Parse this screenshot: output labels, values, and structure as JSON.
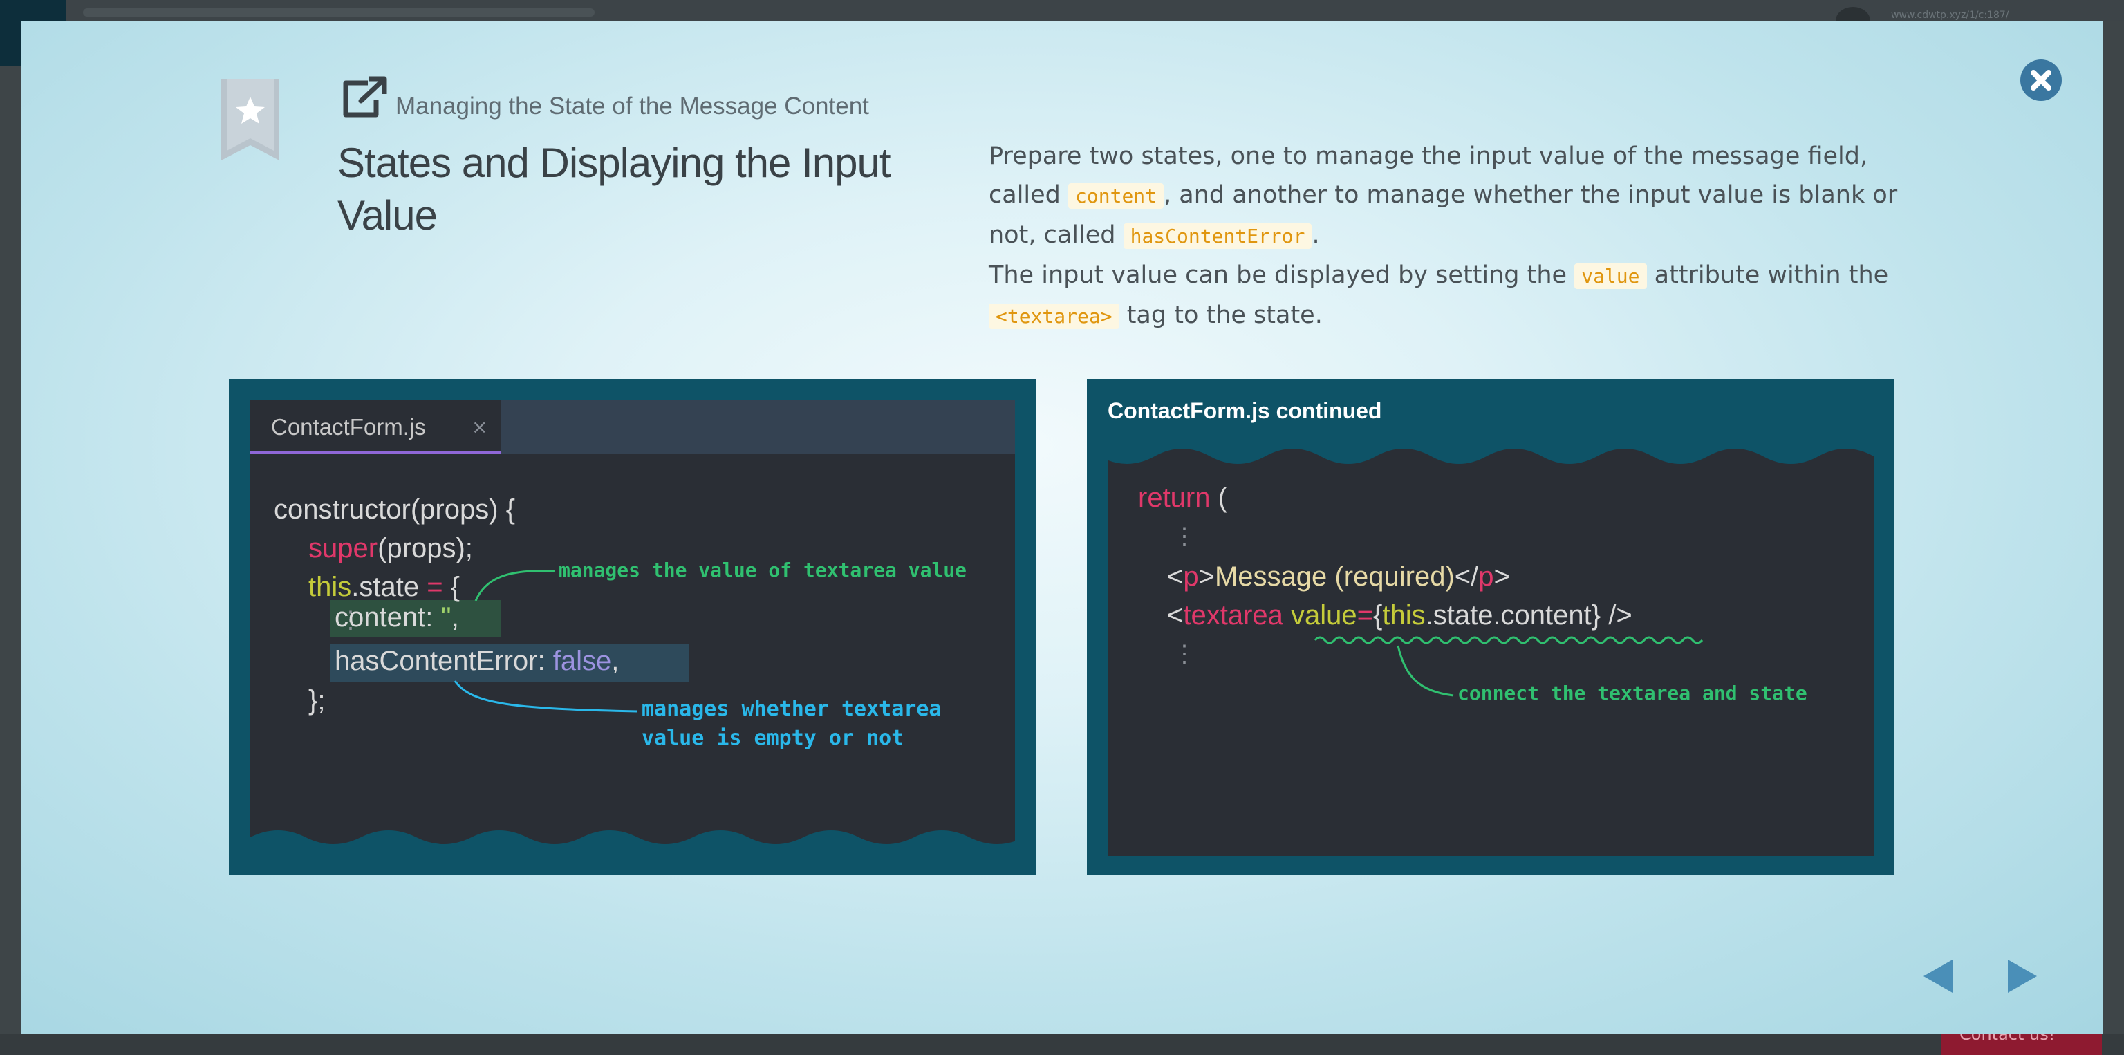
{
  "backdrop": {
    "url_text": "www.cdwtp.xyz/1/c:187/",
    "contact_label": "Contact us!"
  },
  "header": {
    "chapter": "Managing the State of the Message Content",
    "title": "States and Displaying the Input Value"
  },
  "description": {
    "p1_before": "Prepare two states, one to manage the input value of the message field, called ",
    "p1_code1": "content",
    "p1_mid": ", and another to manage whether the input value is blank or not, called ",
    "p1_code2": "hasContentError",
    "p1_end": ".",
    "p2_before": "The input value can be displayed by setting the ",
    "p2_code1": "value",
    "p2_mid": " attribute within the ",
    "p2_code2": "<textarea>",
    "p2_end": " tag to the state."
  },
  "left_panel": {
    "tab_label": "ContactForm.js",
    "tab_close": "×",
    "code": {
      "l1": "constructor(props) {",
      "l2_kw": "super",
      "l2_rest": "(props);",
      "l3_kw": "this",
      "l3_mid": ".state ",
      "l3_eq": "=",
      "l3_end": " {",
      "dots": "⋮",
      "l5_key": "content: ",
      "l5_val": "''",
      "l5_end": ",",
      "l6_key": "hasContentError: ",
      "l6_val": "false",
      "l6_end": ",",
      "l7": "};"
    },
    "annotation_green": "manages the value of textarea value",
    "annotation_blue_1": "manages whether textarea",
    "annotation_blue_2": "value is empty or not"
  },
  "right_panel": {
    "title": "ContactForm.js continued",
    "code": {
      "l1_kw": "return",
      "l1_end": " (",
      "dots": "⋮",
      "l3_lt": "<",
      "l3_tag": "p",
      "l3_gt": ">",
      "l3_text": "Message (required)",
      "l3_close_lt": "</",
      "l3_close_tag": "p",
      "l3_close_gt": ">",
      "l4_lt": "<",
      "l4_tag": "textarea",
      "l4_attr": " value",
      "l4_eq": "=",
      "l4_brace_open": "{",
      "l4_this": "this",
      "l4_rest": ".state.content",
      "l4_brace_close": "}",
      "l4_end": " />"
    },
    "annotation_green": "connect the textarea and state"
  },
  "colors": {
    "panel_bg": "#0e5367",
    "code_bg": "#2a2e35",
    "accent_close": "#3a77a0",
    "nav_arrow": "#4a8fb8"
  }
}
